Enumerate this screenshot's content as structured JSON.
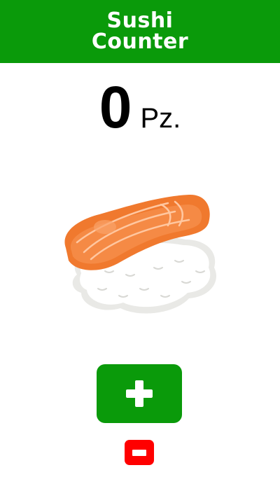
{
  "header": {
    "title": "Sushi\nCounter"
  },
  "counter": {
    "value": "0",
    "unit": "Pz."
  },
  "illustration": {
    "icon": "sushi-nigiri-icon"
  },
  "controls": {
    "increment_icon": "plus-icon",
    "decrement_icon": "minus-icon"
  },
  "colors": {
    "header_bg": "#0a9a0a",
    "plus_bg": "#0a9a0a",
    "minus_bg": "#ff0000"
  }
}
